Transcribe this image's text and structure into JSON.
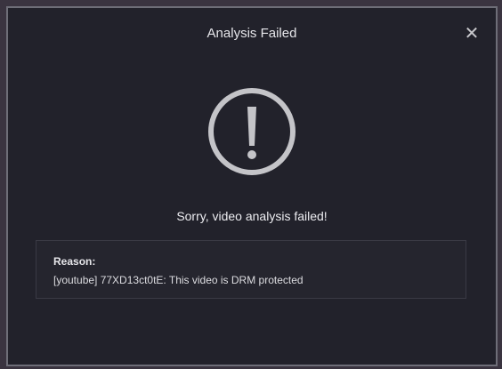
{
  "dialog": {
    "title": "Analysis Failed",
    "close_label": "✕",
    "icon": "exclamation-circle-icon",
    "message": "Sorry, video analysis failed!",
    "reason": {
      "label": "Reason:",
      "text": "[youtube] 77XD13ct0tE: This video is DRM protected"
    }
  },
  "colors": {
    "background": "#22222b",
    "border": "#6e6e78",
    "icon": "#c4c4c8",
    "text": "#e6e6ea"
  }
}
